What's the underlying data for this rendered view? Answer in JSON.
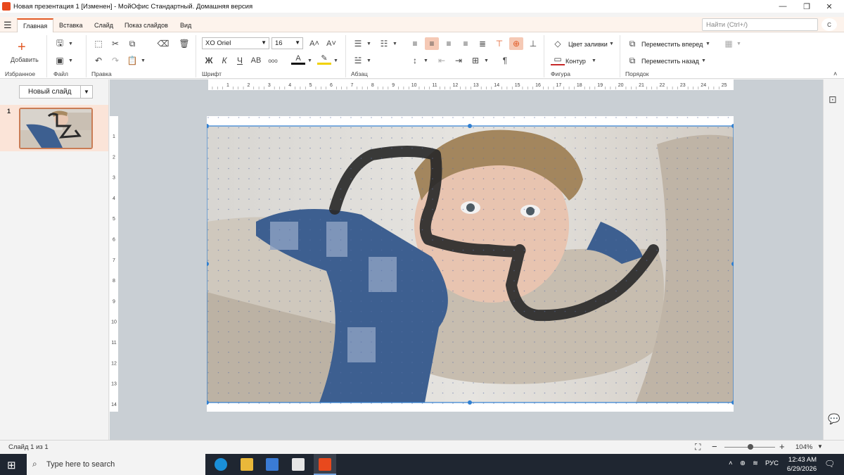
{
  "window": {
    "title": "Новая презентация 1 [Изменен] - МойОфис Стандартный. Домашняя версия",
    "minimize_icon": "minimize-icon",
    "maximize_icon": "restore-icon",
    "close_icon": "close-icon"
  },
  "menu": {
    "tabs": [
      {
        "label": "Главная",
        "active": true
      },
      {
        "label": "Вставка"
      },
      {
        "label": "Слайд"
      },
      {
        "label": "Показ слайдов"
      },
      {
        "label": "Вид"
      }
    ],
    "search_placeholder": "Найти (Ctrl+/)",
    "user_initial": "C"
  },
  "ribbon": {
    "add_label": "Добавить",
    "groups": {
      "favorites": "Избранное",
      "file": "Файл",
      "edit": "Правка",
      "font": "Шрифт",
      "paragraph": "Абзац",
      "shape": "Фигура",
      "order": "Порядок"
    },
    "font_name": "XO Oriel",
    "font_size": "16",
    "bold_label": "Ж",
    "italic_label": "К",
    "underline_label": "Ч",
    "caps_label": "AB",
    "more_label": "ооо",
    "fill_color": "Цвет заливки",
    "outline": "Контур",
    "bring_forward": "Переместить вперед",
    "send_backward": "Переместить назад",
    "accent_color": "#e25a26"
  },
  "left_panel": {
    "new_slide_label": "Новый слайд",
    "slide_number": "1"
  },
  "ruler": {
    "h_ticks": [
      "1",
      "2",
      "3",
      "4",
      "5",
      "6",
      "7",
      "8",
      "9",
      "10",
      "11",
      "12",
      "13",
      "14",
      "15",
      "16",
      "17",
      "18",
      "19",
      "20",
      "21",
      "22",
      "23",
      "24",
      "25"
    ],
    "v_ticks": [
      "1",
      "2",
      "3",
      "4",
      "5",
      "6",
      "7",
      "8",
      "9",
      "10",
      "11",
      "12",
      "13",
      "14"
    ]
  },
  "status": {
    "slide_count": "Слайд 1 из 1",
    "zoom": "104%",
    "zoom_level": 0.52
  },
  "taskbar": {
    "search_placeholder": "Type here to search",
    "lang": "РУС",
    "time": "12:43 AM",
    "date": "6/29/2026"
  }
}
